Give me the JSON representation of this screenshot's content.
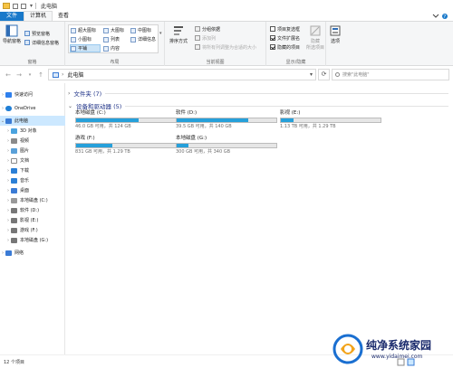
{
  "titlebar": {
    "title": "此电脑",
    "caret": "▾"
  },
  "tabs": [
    {
      "label": "文件"
    },
    {
      "label": "计算机"
    },
    {
      "label": "查看"
    }
  ],
  "ribbon": {
    "panes": {
      "label": "导航窗格",
      "preview": "预览窗格",
      "details": "详细信息窗格",
      "group": "窗格"
    },
    "layout": {
      "items": [
        "超大图标",
        "大图标",
        "中图标",
        "小图标",
        "列表",
        "详细信息",
        "平铺",
        "内容"
      ],
      "group": "布局"
    },
    "sort": {
      "label": "排序方式",
      "groupby": "分组依据",
      "addcol": "添加列",
      "fitcol": "将所有列调整为合适的大小",
      "group": "当前视图"
    },
    "showhide": {
      "checkboxes": "项目复选框",
      "extensions": "文件扩展名",
      "hidden": "隐藏的项目",
      "hide": "隐藏",
      "hide2": "所选项目",
      "group": "显示/隐藏"
    },
    "options": {
      "label": "选项"
    }
  },
  "address": {
    "separator": "›",
    "crumb": "此电脑",
    "search_placeholder": "搜索\"此电脑\""
  },
  "sidebar": {
    "items": [
      {
        "label": "快速访问",
        "color": "#2f80ed"
      },
      {
        "label": "OneDrive",
        "color": "#1f7fd6"
      },
      {
        "label": "此电脑",
        "color": "#3a7bd5"
      },
      {
        "label": "3D 对象",
        "color": "#4aa3df"
      },
      {
        "label": "视频",
        "color": "#8a8a8a"
      },
      {
        "label": "图片",
        "color": "#5aa0d8"
      },
      {
        "label": "文档",
        "color": "#8a8a8a"
      },
      {
        "label": "下载",
        "color": "#2b7fd6"
      },
      {
        "label": "音乐",
        "color": "#2b7fd6"
      },
      {
        "label": "桌面",
        "color": "#3a7bd5"
      },
      {
        "label": "本地磁盘 (C:)",
        "color": "#777777"
      },
      {
        "label": "软件 (D:)",
        "color": "#777777"
      },
      {
        "label": "影视 (E:)",
        "color": "#777777"
      },
      {
        "label": "游戏 (F:)",
        "color": "#777777"
      },
      {
        "label": "本地磁盘 (G:)",
        "color": "#777777"
      },
      {
        "label": "网络",
        "color": "#3a7bd5"
      }
    ]
  },
  "main": {
    "folders_header": "文件夹 (7)",
    "devices_header": "设备和驱动器 (5)",
    "drives": [
      {
        "name": "本地磁盘 (C:)",
        "free": "46.0 GB 可用，共 124 GB",
        "used_fraction": 0.63
      },
      {
        "name": "软件 (D:)",
        "free": "39.5 GB 可用，共 140 GB",
        "used_fraction": 0.72
      },
      {
        "name": "影视 (E:)",
        "free": "1.13 TB 可用，共 1.29 TB",
        "used_fraction": 0.13
      },
      {
        "name": "游戏 (F:)",
        "free": "831 GB 可用，共 1.29 TB",
        "used_fraction": 0.36
      },
      {
        "name": "本地磁盘 (G:)",
        "free": "300 GB 可用，共 340 GB",
        "used_fraction": 0.12
      }
    ]
  },
  "status": {
    "count": "12 个项目"
  },
  "watermark": {
    "text": "纯净系统家园",
    "url": "www.yidaimei.com"
  },
  "colors": {
    "accent": "#1979ca",
    "bar_fill": "#26a0da",
    "selected": "#cce8ff"
  }
}
